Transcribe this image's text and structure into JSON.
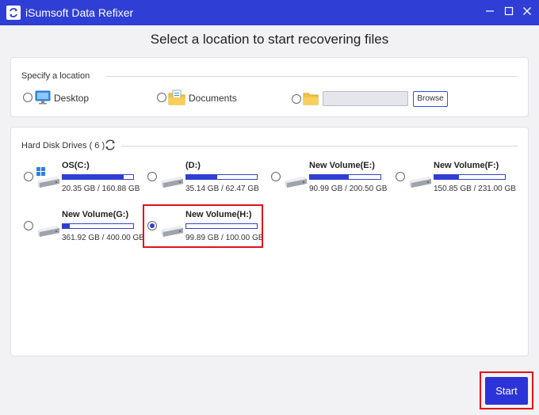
{
  "window": {
    "title": "iSumsoft Data Refixer",
    "logo_icon": "refresh-logo-icon"
  },
  "heading": "Select a location to start recovering files",
  "location": {
    "legend": "Specify a location",
    "options": [
      {
        "label": "Desktop",
        "icon": "desktop-icon",
        "selected": false
      },
      {
        "label": "Documents",
        "icon": "documents-icon",
        "selected": false
      }
    ],
    "custom_path": {
      "value": "",
      "selected": false,
      "icon": "folder-icon"
    },
    "browse_label": "Browse"
  },
  "drives": {
    "legend": "Hard Disk Drives ( 6 )",
    "items": [
      {
        "name": "OS(C:)",
        "size": "20.35 GB / 160.88 GB",
        "used_fraction": 0.87,
        "selected": false,
        "windows_logo": true
      },
      {
        "name": "(D:)",
        "size": "35.14 GB / 62.47 GB",
        "used_fraction": 0.44,
        "selected": false
      },
      {
        "name": "New Volume(E:)",
        "size": "90.99 GB / 200.50 GB",
        "used_fraction": 0.55,
        "selected": false
      },
      {
        "name": "New Volume(F:)",
        "size": "150.85 GB / 231.00 GB",
        "used_fraction": 0.35,
        "selected": false
      },
      {
        "name": "New Volume(G:)",
        "size": "361.92 GB / 400.00 GB",
        "used_fraction": 0.1,
        "selected": false
      },
      {
        "name": "New Volume(H:)",
        "size": "99.89 GB / 100.00 GB",
        "used_fraction": 0.0,
        "selected": true
      }
    ]
  },
  "start_label": "Start",
  "colors": {
    "accent": "#2f3fd6",
    "highlight": "#e0121c"
  }
}
